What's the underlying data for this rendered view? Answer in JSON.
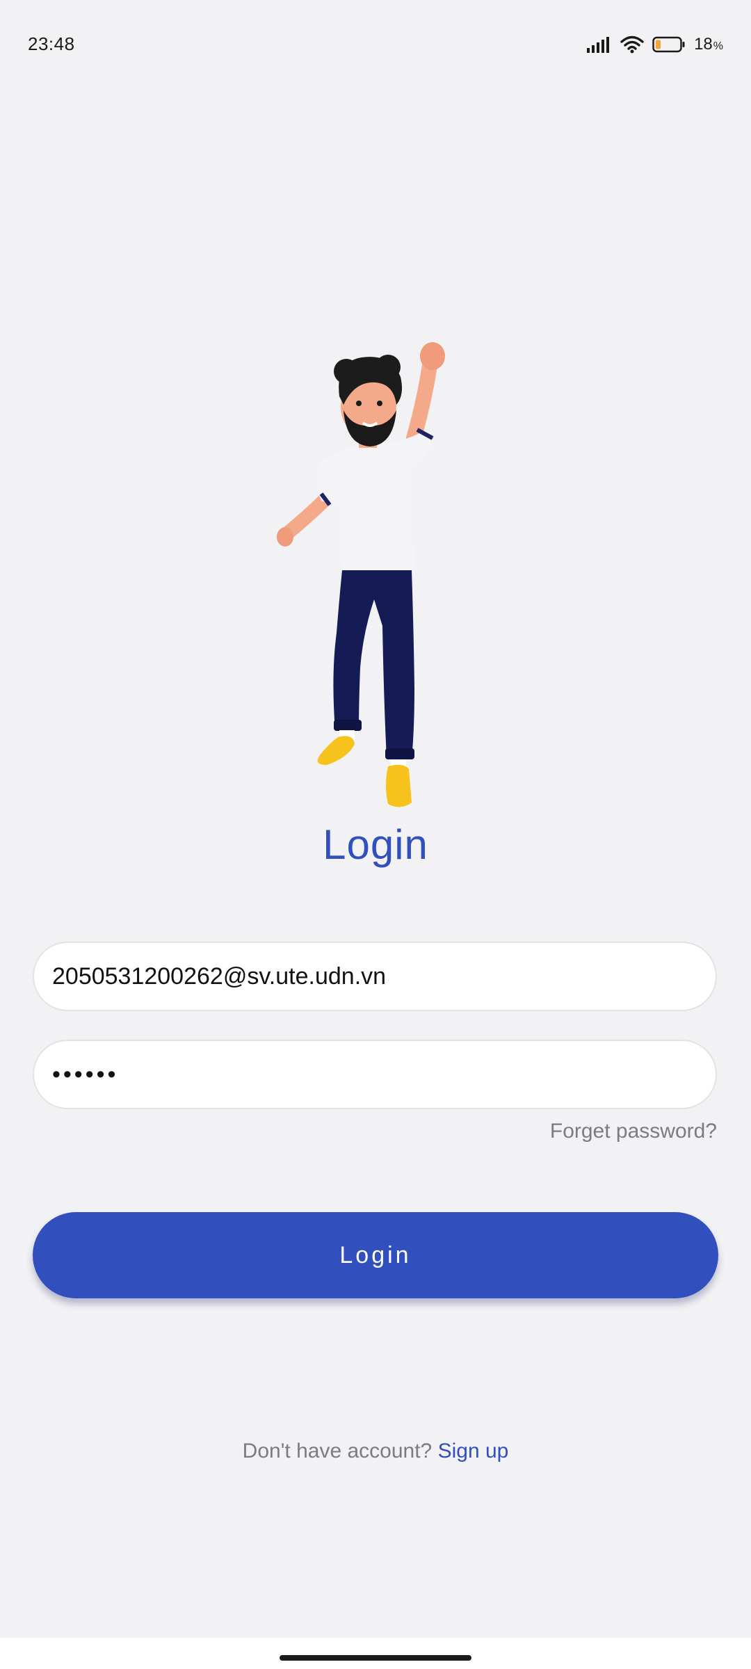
{
  "status_bar": {
    "time": "23:48",
    "battery_level": "18",
    "battery_unit": "%",
    "icons": [
      "signal-icon",
      "wifi-icon",
      "battery-icon"
    ]
  },
  "illustration": {
    "name": "jumping-man-illustration"
  },
  "login_form": {
    "title": "Login",
    "email_value": "2050531200262@sv.ute.udn.vn",
    "password_value": "••••••",
    "forgot_password_label": "Forget password?",
    "login_button_label": "Login"
  },
  "footer": {
    "no_account_text": "Don't have account?",
    "signup_label": "Sign up"
  },
  "colors": {
    "accent": "#3250bd",
    "background": "#f2f2f4",
    "muted_text": "#7b7b80",
    "field_background": "#ffffff",
    "battery_low": "#f0a830"
  }
}
